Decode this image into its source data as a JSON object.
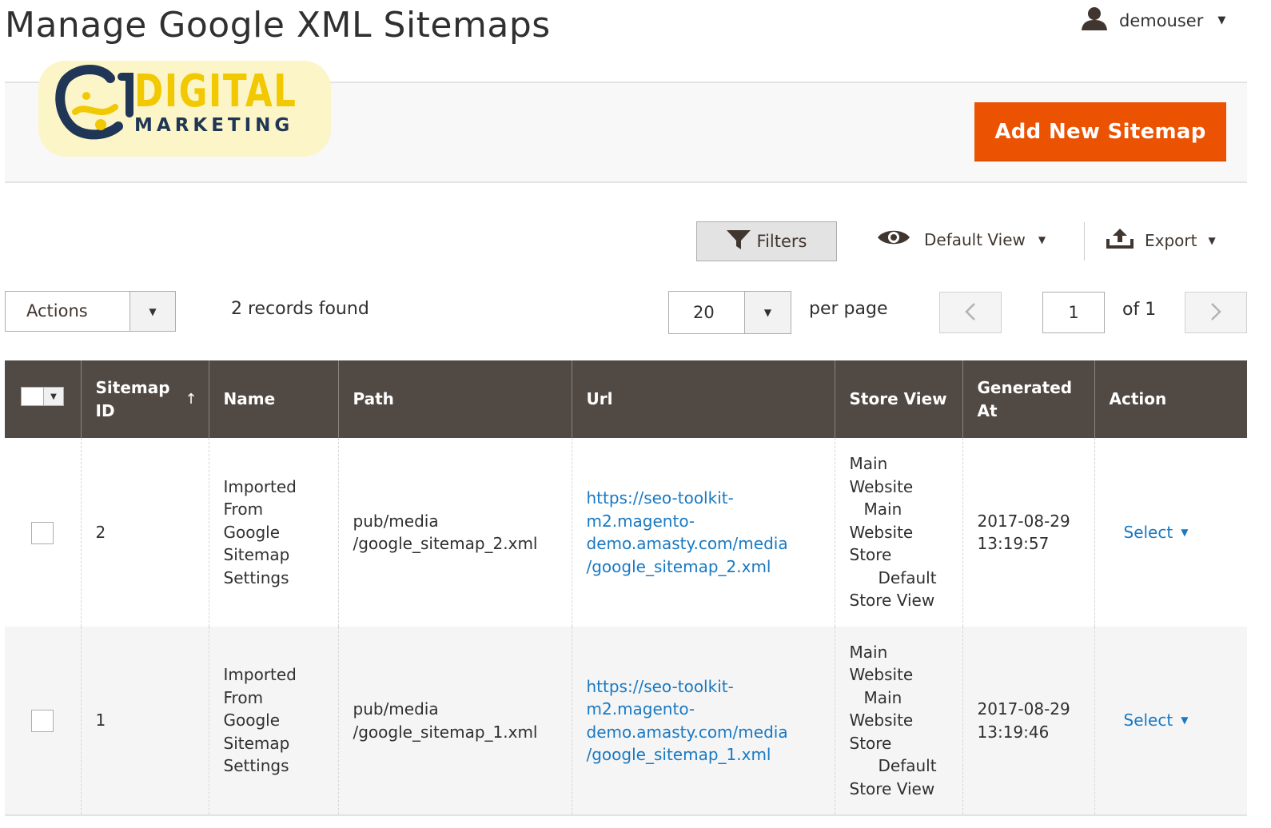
{
  "header": {
    "title": "Manage Google XML Sitemaps",
    "user": "demouser"
  },
  "logo": {
    "line1": "DIGITAL",
    "line2": "MARKETING"
  },
  "actions_bar": {
    "add_label": "Add New Sitemap"
  },
  "toolbar": {
    "filters_label": "Filters",
    "view_label": "Default View",
    "export_label": "Export",
    "mass_actions_label": "Actions",
    "records_found": "2 records found",
    "per_page_value": "20",
    "per_page_label": "per page",
    "current_page": "1",
    "of_pages": "of 1"
  },
  "grid": {
    "columns": {
      "id": "Sitemap ID",
      "name": "Name",
      "path": "Path",
      "url": "Url",
      "store_view": "Store View",
      "generated_at": "Generated At",
      "action": "Action"
    },
    "rows": [
      {
        "id": "2",
        "name_lines": [
          "Imported",
          "From",
          "Google",
          "Sitemap",
          "Settings"
        ],
        "path_lines": [
          "pub/media",
          "/google_sitemap_2.xml"
        ],
        "url_lines": [
          "https://seo-toolkit-",
          "m2.magento-",
          "demo.amasty.com/media",
          "/google_sitemap_2.xml"
        ],
        "store_lines": [
          "Main",
          "Website",
          "Main",
          "Website",
          "Store",
          "Default",
          "Store View"
        ],
        "date": "2017-08-29",
        "time": "13:19:57",
        "action": "Select"
      },
      {
        "id": "1",
        "name_lines": [
          "Imported",
          "From",
          "Google",
          "Sitemap",
          "Settings"
        ],
        "path_lines": [
          "pub/media",
          "/google_sitemap_1.xml"
        ],
        "url_lines": [
          "https://seo-toolkit-",
          "m2.magento-",
          "demo.amasty.com/media",
          "/google_sitemap_1.xml"
        ],
        "store_lines": [
          "Main",
          "Website",
          "Main",
          "Website",
          "Store",
          "Default",
          "Store View"
        ],
        "date": "2017-08-29",
        "time": "13:19:46",
        "action": "Select"
      }
    ]
  },
  "colors": {
    "accent": "#eb5202",
    "header_bg": "#514943",
    "link": "#1979c3"
  }
}
